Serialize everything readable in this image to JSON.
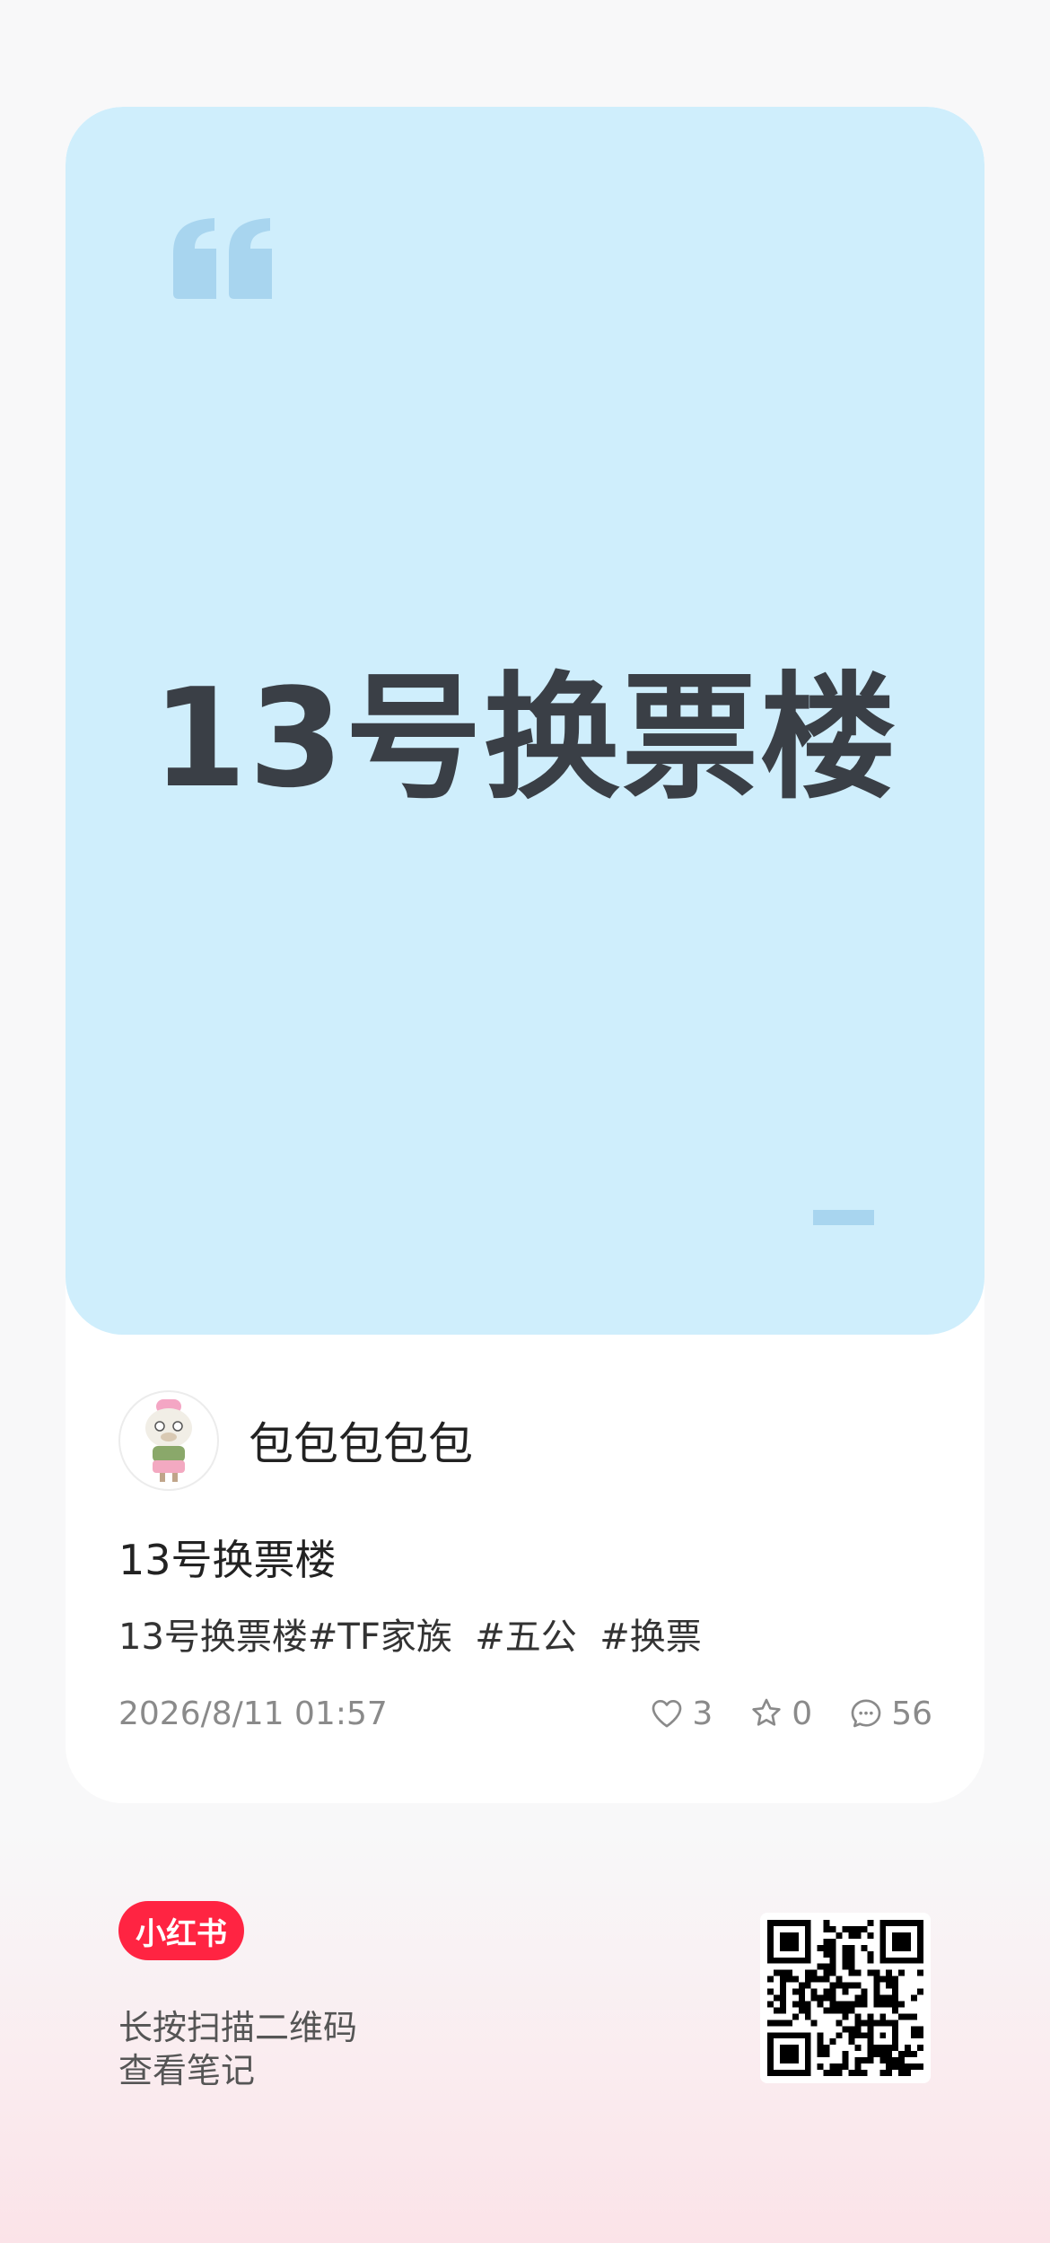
{
  "cover": {
    "text": "13号换票楼"
  },
  "author": {
    "name": "包包包包包"
  },
  "note": {
    "title": "13号换票楼",
    "tags_line": "13号换票楼#TF家族  #五公  #换票",
    "date": "2026/8/11 01:57",
    "likes": "3",
    "collects": "0",
    "comments": "56"
  },
  "footer": {
    "brand": "小红书",
    "scan_line1": "长按扫描二维码",
    "scan_line2": "查看笔记"
  },
  "colors": {
    "cover_bg": "#cfeefc",
    "quote_mark": "#a8d5ef",
    "brand_red": "#ff2442",
    "heading_text": "#3a3f46"
  },
  "icons": [
    "quote-icon",
    "heart-icon",
    "star-icon",
    "comment-icon",
    "qr-code"
  ]
}
